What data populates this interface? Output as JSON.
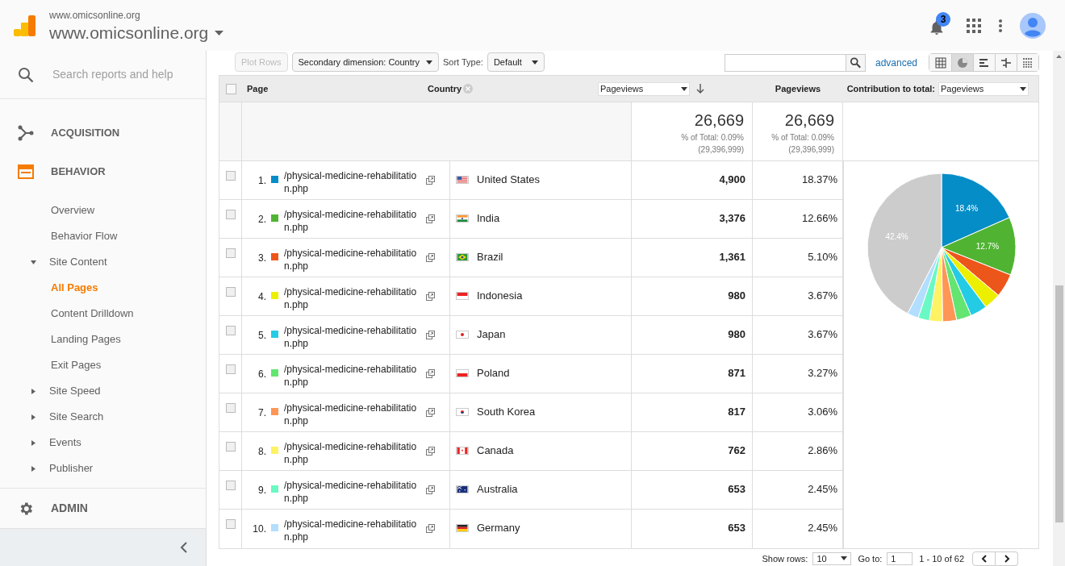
{
  "header": {
    "subtitle": "www.omicsonline.org",
    "title": "www.omicsonline.org",
    "notification_count": "3"
  },
  "sidebar": {
    "search": {
      "placeholder": "Search reports and help"
    },
    "sections": [
      {
        "kind": "acquisition",
        "label": "ACQUISITION",
        "selected": false
      },
      {
        "kind": "behavior",
        "label": "BEHAVIOR",
        "selected": true
      }
    ],
    "items": [
      {
        "label": "Overview"
      },
      {
        "label": "Behavior Flow"
      },
      {
        "label": "Site Content",
        "expanded": true,
        "children": [
          {
            "label": "All Pages",
            "selected": true
          },
          {
            "label": "Content Drilldown",
            "selected": false
          },
          {
            "label": "Landing Pages",
            "selected": false
          },
          {
            "label": "Exit Pages",
            "selected": false
          }
        ]
      },
      {
        "label": "Site Speed",
        "expanded": false
      },
      {
        "label": "Site Search",
        "expanded": false
      },
      {
        "label": "Events",
        "expanded": false
      },
      {
        "label": "Publisher",
        "expanded": false
      }
    ],
    "admin": "ADMIN"
  },
  "toolbar": {
    "plot_rows": {
      "label": "Plot Rows",
      "disabled": true
    },
    "secondary_dimension": "Secondary dimension: Country",
    "sort_type_label": "Sort Type:",
    "sort_type": "Default",
    "advanced": "advanced",
    "views": [
      {
        "kind": "table",
        "selected": false
      },
      {
        "kind": "pie",
        "selected": true
      },
      {
        "kind": "bars",
        "selected": false
      },
      {
        "kind": "comparison",
        "selected": false
      },
      {
        "kind": "pivot",
        "selected": false
      }
    ]
  },
  "table": {
    "select_all_checked": false,
    "columns": {
      "page": "Page",
      "country": "Country",
      "metric_select": "Pageviews",
      "metric": "Pageviews",
      "contribution_label": "Contribution to total:",
      "contribution_select": "Pageviews"
    },
    "totals": [
      {
        "value": "26,669",
        "percent": "% of Total: 0.09%",
        "total": "(29,396,999)"
      },
      {
        "value": "26,669",
        "percent": "% of Total: 0.09%",
        "total": "(29,396,999)"
      }
    ],
    "rows": [
      {
        "index": "1.",
        "color": "#058dc7",
        "page": "/physical-medicine-rehabilitation.php",
        "country": "United States",
        "pageviews": "4,900",
        "percent": "18.37%",
        "checked": false
      },
      {
        "index": "2.",
        "color": "#50b432",
        "page": "/physical-medicine-rehabilitation.php",
        "country": "India",
        "pageviews": "3,376",
        "percent": "12.66%",
        "checked": false
      },
      {
        "index": "3.",
        "color": "#ed561b",
        "page": "/physical-medicine-rehabilitation.php",
        "country": "Brazil",
        "pageviews": "1,361",
        "percent": "5.10%",
        "checked": false
      },
      {
        "index": "4.",
        "color": "#edef00",
        "page": "/physical-medicine-rehabilitation.php",
        "country": "Indonesia",
        "pageviews": "980",
        "percent": "3.67%",
        "checked": false
      },
      {
        "index": "5.",
        "color": "#24cbe5",
        "page": "/physical-medicine-rehabilitation.php",
        "country": "Japan",
        "pageviews": "980",
        "percent": "3.67%",
        "checked": false
      },
      {
        "index": "6.",
        "color": "#64e572",
        "page": "/physical-medicine-rehabilitation.php",
        "country": "Poland",
        "pageviews": "871",
        "percent": "3.27%",
        "checked": false
      },
      {
        "index": "7.",
        "color": "#ff9655",
        "page": "/physical-medicine-rehabilitation.php",
        "country": "South Korea",
        "pageviews": "817",
        "percent": "3.06%",
        "checked": false
      },
      {
        "index": "8.",
        "color": "#fff263",
        "page": "/physical-medicine-rehabilitation.php",
        "country": "Canada",
        "pageviews": "762",
        "percent": "2.86%",
        "checked": false
      },
      {
        "index": "9.",
        "color": "#6af9c4",
        "page": "/physical-medicine-rehabilitation.php",
        "country": "Australia",
        "pageviews": "653",
        "percent": "2.45%",
        "checked": false
      },
      {
        "index": "10.",
        "color": "#b2deff",
        "page": "/physical-medicine-rehabilitation.php",
        "country": "Germany",
        "pageviews": "653",
        "percent": "2.45%",
        "checked": false
      }
    ],
    "chart_data": {
      "type": "pie",
      "values": [
        18.37,
        12.66,
        5.1,
        3.67,
        3.67,
        3.27,
        3.06,
        2.86,
        2.45,
        2.45,
        42.44
      ],
      "value_labels": [
        "18.4%",
        "12.7%",
        null,
        null,
        null,
        null,
        null,
        null,
        null,
        null,
        "42.4%"
      ]
    }
  },
  "pagination": {
    "show_rows_label": "Show rows:",
    "show_rows": "10",
    "goto_label": "Go to:",
    "goto": "1",
    "range": "1 - 10 of 62"
  }
}
